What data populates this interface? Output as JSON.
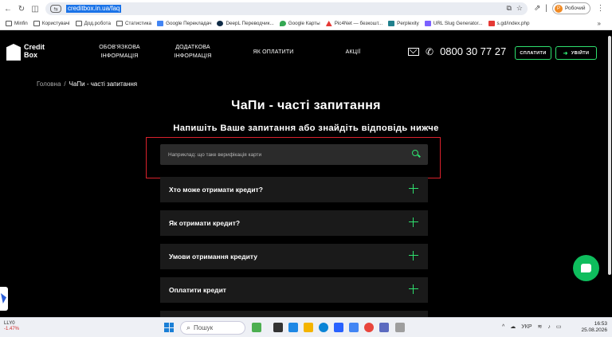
{
  "browser": {
    "url": "creditbox.in.ua/faq",
    "profile_label": "Робочий",
    "bookmarks": [
      "Minfin",
      "Користувачі",
      "Дод.робота",
      "Статистика",
      "Google Перекладач",
      "DeepL Переводчик...",
      "Google Карты",
      "Pic4Net — безкошт...",
      "Perplexity",
      "URL Slug Generator...",
      "s.gd/index.php"
    ]
  },
  "header": {
    "logo_line1": "Credit",
    "logo_line2": "Box",
    "nav": [
      {
        "line1": "ОБОВ'ЯЗКОВА",
        "line2": "ІНФОРМАЦІЯ"
      },
      {
        "line1": "ДОДАТКОВА",
        "line2": "ІНФОРМАЦІЯ"
      },
      {
        "line1": "ЯК ОПЛАТИТИ",
        "line2": ""
      },
      {
        "line1": "АКЦІЇ",
        "line2": ""
      }
    ],
    "phone": "0800 30 77 27",
    "pay_label": "СПЛАТИТИ",
    "login_label": "УВІЙТИ"
  },
  "breadcrumb": {
    "home": "Головна",
    "separator": "/",
    "current": "ЧаПи - часті запитання"
  },
  "page": {
    "title": "ЧаПи - часті запитання",
    "subtitle": "Напишіть Ваше запитання або знайдіть відповідь нижче",
    "search_placeholder": "Наприклад: що таке верифікація карти"
  },
  "faq": [
    "Хто може отримати кредит?",
    "Як отримати кредит?",
    "Умови отримання кредиту",
    "Оплатити кредит"
  ],
  "taskbar": {
    "ticker_name": "LLY0",
    "ticker_change": "-1.47%",
    "search_label": "Пошук",
    "language": "УКР",
    "time": "16:53",
    "date": "25.08.2026"
  },
  "colors": {
    "accent": "#2ee06e",
    "highlight_frame": "#d9212c",
    "background": "#000000"
  }
}
